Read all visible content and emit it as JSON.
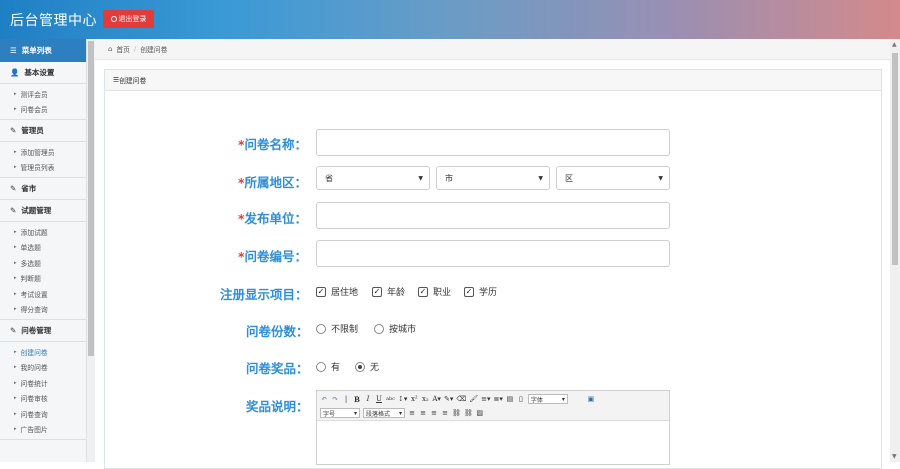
{
  "app": {
    "title": "后台管理中心",
    "logout_label": "退出登录"
  },
  "sidebar": {
    "header": "菜单列表",
    "sections": [
      {
        "label": "基本设置",
        "icon": "user-icon",
        "items": [
          "测评会员",
          "问卷会员"
        ]
      },
      {
        "label": "管理员",
        "icon": "edit-icon",
        "items": [
          "添加管理员",
          "管理员列表"
        ]
      },
      {
        "label": "省市",
        "icon": "edit-icon",
        "items": []
      },
      {
        "label": "试题管理",
        "icon": "edit-icon",
        "items": [
          "添加试题",
          "单选题",
          "多选题",
          "判断题",
          "考试设置",
          "得分查询"
        ]
      },
      {
        "label": "问卷管理",
        "icon": "edit-icon",
        "items": [
          "创建问卷",
          "我的问卷",
          "问卷统计",
          "问卷审核",
          "问卷查询",
          "广告图片"
        ]
      }
    ],
    "active_item": "创建问卷"
  },
  "breadcrumb": {
    "home": "首页",
    "current": "创建问卷"
  },
  "panel": {
    "title": "创建问卷"
  },
  "form": {
    "survey_name_label": "问卷名称：",
    "region_label": "所属地区：",
    "province": "省",
    "city": "市",
    "district": "区",
    "publisher_label": "发布单位：",
    "survey_no_label": "问卷编号：",
    "reg_fields_label": "注册显示项目：",
    "reg_fields": [
      "居住地",
      "年龄",
      "职业",
      "学历"
    ],
    "copies_label": "问卷份数：",
    "copies_options": [
      "不限制",
      "按城市"
    ],
    "prize_label": "问卷奖品：",
    "prize_options": [
      "有",
      "无"
    ],
    "prize_selected": "无",
    "prize_desc_label": "奖品说明：",
    "required_mark": "*"
  },
  "editor": {
    "font_family": "字体",
    "font_size": "字号",
    "paragraph": "段落格式"
  }
}
